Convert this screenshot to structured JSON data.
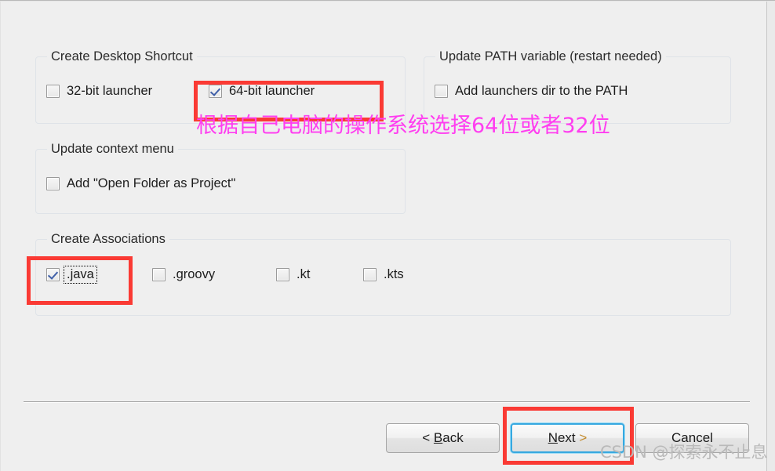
{
  "window": {
    "background_color": "#efefef"
  },
  "groups": {
    "desktop_shortcut": {
      "title": "Create Desktop Shortcut",
      "options": [
        {
          "label": "32-bit launcher",
          "checked": false,
          "focused": false
        },
        {
          "label": "64-bit launcher",
          "checked": true,
          "focused": false
        }
      ]
    },
    "path_variable": {
      "title": "Update PATH variable (restart needed)",
      "options": [
        {
          "label": "Add launchers dir to the PATH",
          "checked": false,
          "focused": false
        }
      ]
    },
    "context_menu": {
      "title": "Update context menu",
      "options": [
        {
          "label": "Add \"Open Folder as Project\"",
          "checked": false,
          "focused": false
        }
      ]
    },
    "associations": {
      "title": "Create Associations",
      "options": [
        {
          "label": ".java",
          "checked": true,
          "focused": true
        },
        {
          "label": ".groovy",
          "checked": false,
          "focused": false
        },
        {
          "label": ".kt",
          "checked": false,
          "focused": false
        },
        {
          "label": ".kts",
          "checked": false,
          "focused": false
        }
      ]
    }
  },
  "annotations": {
    "highlight_color": "#fa3a34",
    "note_color": "#ff3ef0",
    "note_text": "根据自己电脑的操作系统选择64位或者32位"
  },
  "footer": {
    "buttons": [
      {
        "name": "back",
        "prefix": "< ",
        "mnemonic": "B",
        "suffix": "ack",
        "focused": false
      },
      {
        "name": "next",
        "prefix": "",
        "mnemonic": "N",
        "suffix": "ext >",
        "focused": true
      },
      {
        "name": "cancel",
        "prefix": "",
        "mnemonic": "",
        "suffix": "Cancel",
        "focused": false
      }
    ],
    "back_label": "< Back",
    "next_label": "Next >",
    "cancel_label": "Cancel"
  },
  "watermark": {
    "text": "CSDN @探索永不止息"
  }
}
